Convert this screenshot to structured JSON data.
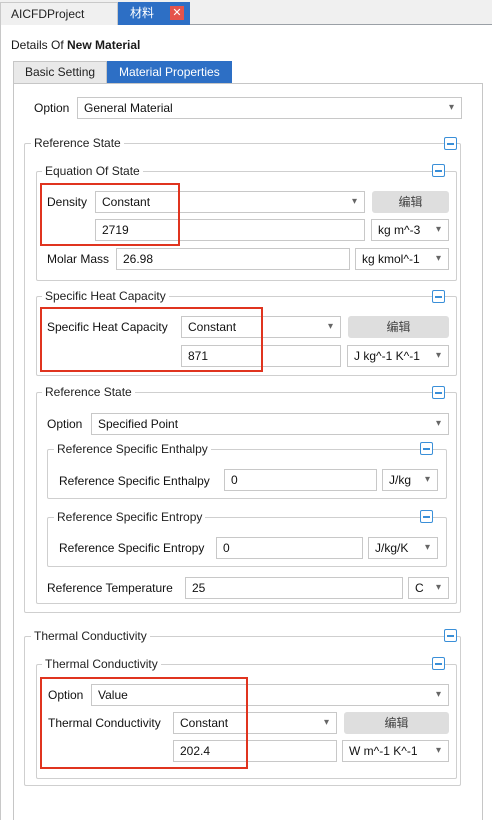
{
  "tabs": {
    "project": "AICFDProject",
    "material": "材料",
    "close": "✕"
  },
  "header": {
    "details_prefix": "Details Of ",
    "material_name": "New Material"
  },
  "panel_tabs": {
    "basic": "Basic Setting",
    "props": "Material Properties"
  },
  "top_option": {
    "label": "Option",
    "value": "General Material"
  },
  "reference_state_outer": {
    "title": "Reference State"
  },
  "equation_of_state": {
    "title": "Equation Of State",
    "density_label": "Density",
    "density_mode": "Constant",
    "edit_button": "编辑",
    "density_value": "2719",
    "density_unit": "kg m^-3",
    "molar_label": "Molar Mass",
    "molar_value": "26.98",
    "molar_unit": "kg kmol^-1"
  },
  "specific_heat": {
    "title": "Specific Heat Capacity",
    "label": "Specific Heat Capacity",
    "mode": "Constant",
    "edit_button": "编辑",
    "value": "871",
    "unit": "J kg^-1 K^-1"
  },
  "reference_state_inner": {
    "title": "Reference State",
    "option_label": "Option",
    "option_value": "Specified Point",
    "enthalpy_group": "Reference Specific Enthalpy",
    "enthalpy_label": "Reference Specific Enthalpy",
    "enthalpy_value": "0",
    "enthalpy_unit": "J/kg",
    "entropy_group": "Reference Specific Entropy",
    "entropy_label": "Reference Specific Entropy",
    "entropy_value": "0",
    "entropy_unit": "J/kg/K",
    "temp_label": "Reference Temperature",
    "temp_value": "25",
    "temp_unit": "C"
  },
  "thermal_outer": {
    "title": "Thermal Conductivity"
  },
  "thermal_inner": {
    "title": "Thermal Conductivity",
    "option_label": "Option",
    "option_value": "Value",
    "tc_label": "Thermal Conductivity",
    "tc_mode": "Constant",
    "edit_button": "编辑",
    "tc_value": "202.4",
    "tc_unit": "W m^-1 K^-1"
  },
  "colors": {
    "accent": "#2d6fc5",
    "highlight": "#e0341f",
    "collapse": "#3a8fd8"
  }
}
